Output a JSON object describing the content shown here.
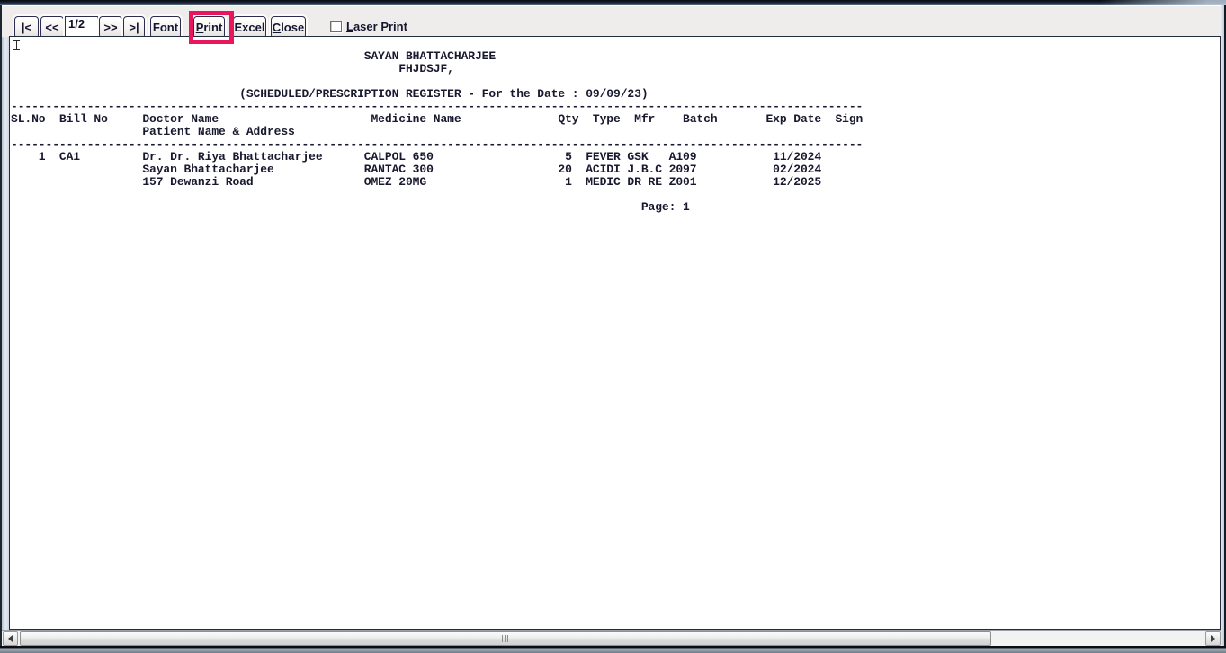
{
  "toolbar": {
    "nav_first": "|<",
    "nav_prev": "<<",
    "page_indicator": "1/2",
    "nav_next": ">>",
    "nav_last": ">|",
    "font_button": "Font",
    "print_button_u": "P",
    "print_button_rest": "rint",
    "excel_button": "Excel",
    "close_button_u": "C",
    "close_button_rest": "lose",
    "laser_print_u": "L",
    "laser_print_rest": "aser Print",
    "laser_print_checked": false
  },
  "colors": {
    "print_highlight_box": "#e8175d"
  },
  "report": {
    "org_name": "SAYAN BHATTACHARJEE",
    "org_line2": "FHJDSJF,",
    "title": "(SCHEDULED/PRESCRIPTION REGISTER - For the Date : 09/09/23)",
    "columns": [
      "SL.No",
      "Bill No",
      "Doctor Name",
      "Patient Name & Address",
      "Medicine Name",
      "Qty",
      "Type",
      "Mfr",
      "Batch",
      "Exp Date",
      "Sign"
    ],
    "rows": [
      {
        "sl_no": "1",
        "bill_no": "CA1",
        "doctor_name": "Dr. Dr. Riya Bhattacharjee",
        "patient_name": "Sayan Bhattacharjee",
        "patient_address": "157 Dewanzi Road",
        "medicines": [
          {
            "name": "CALPOL 650",
            "qty": "5",
            "type": "FEVER",
            "mfr": "GSK",
            "batch": "A109",
            "exp_date": "11/2024",
            "sign": ""
          },
          {
            "name": "RANTAC 300",
            "qty": "20",
            "type": "ACIDI",
            "mfr": "J.B.C",
            "batch": "2097",
            "exp_date": "02/2024",
            "sign": ""
          },
          {
            "name": "OMEZ 20MG",
            "qty": "1",
            "type": "MEDIC",
            "mfr": "DR RE",
            "batch": "Z001",
            "exp_date": "12/2025",
            "sign": ""
          }
        ]
      }
    ],
    "page_label": "Page: 1",
    "display_lines": [
      "",
      "                                                   SAYAN BHATTACHARJEE",
      "                                                        FHJDSJF,",
      "",
      "                                 (SCHEDULED/PRESCRIPTION REGISTER - For the Date : 09/09/23)",
      "---------------------------------------------------------------------------------------------------------------------------",
      "SL.No  Bill No     Doctor Name                      Medicine Name              Qty  Type  Mfr    Batch       Exp Date  Sign",
      "                   Patient Name & Address",
      "---------------------------------------------------------------------------------------------------------------------------",
      "    1  CA1         Dr. Dr. Riya Bhattacharjee      CALPOL 650                   5  FEVER GSK   A109           11/2024",
      "                   Sayan Bhattacharjee             RANTAC 300                  20  ACIDI J.B.C 2097           02/2024",
      "                   157 Dewanzi Road                OMEZ 20MG                    1  MEDIC DR RE Z001           12/2025",
      "",
      "                                                                                           Page: 1"
    ]
  }
}
